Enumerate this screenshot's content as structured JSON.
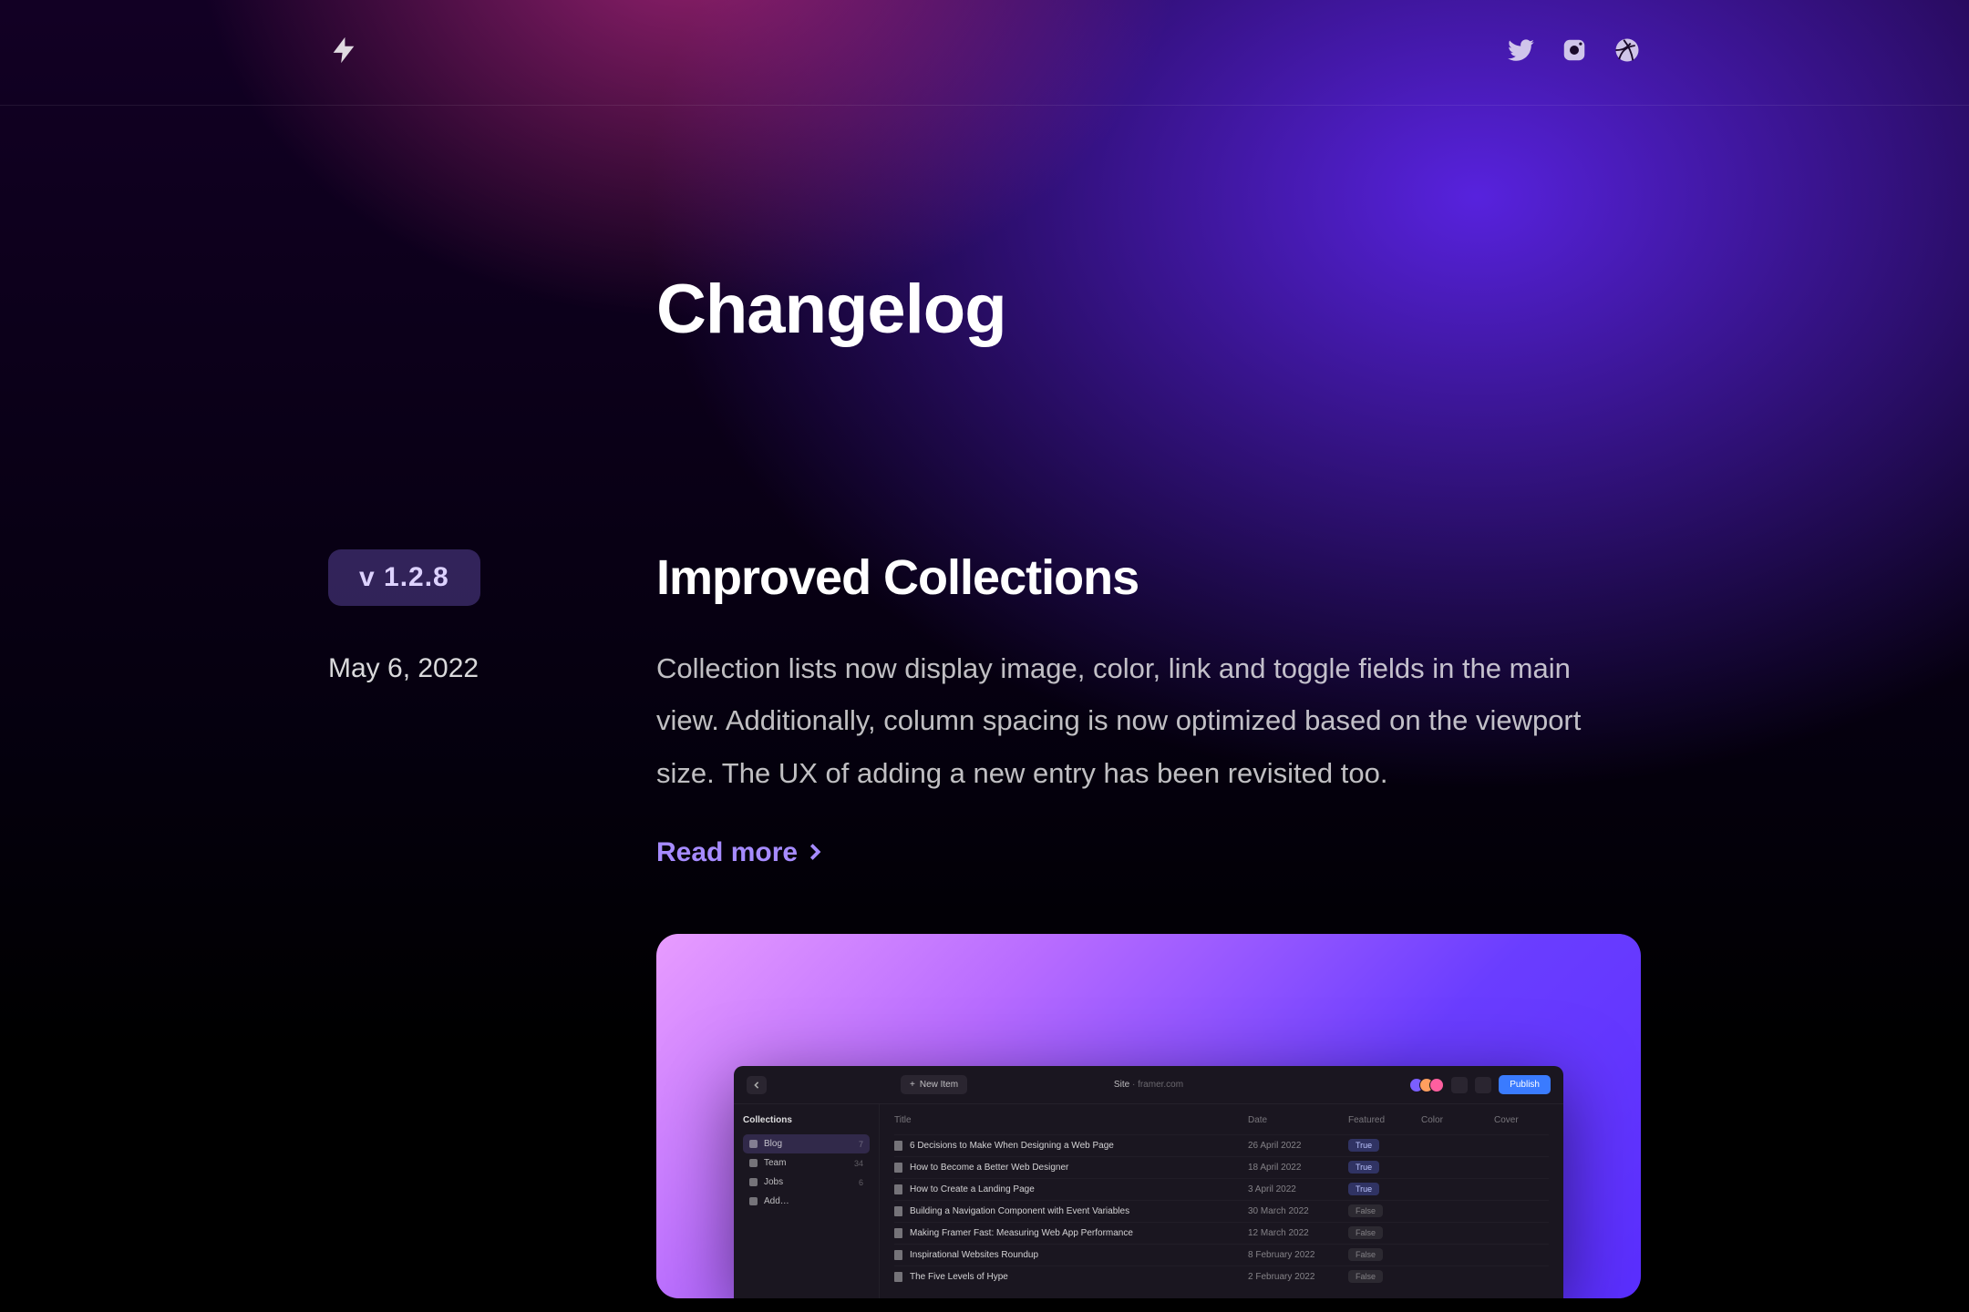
{
  "header": {
    "social": [
      "twitter",
      "instagram",
      "dribbble"
    ]
  },
  "page": {
    "title": "Changelog"
  },
  "entry": {
    "version": "v 1.2.8",
    "date": "May 6, 2022",
    "title": "Improved Collections",
    "description": "Collection lists now display image, color, link and toggle fields in the main view. Additionally, column spacing is now optimized based on the viewport size. The UX of adding a new entry has been revisited too.",
    "read_more": "Read more"
  },
  "screenshot": {
    "new_item": "New Item",
    "site_label": "Site",
    "site_value": "framer.com",
    "publish": "Publish",
    "sidebar_heading": "Collections",
    "sidebar": [
      {
        "label": "Blog",
        "count": "7",
        "active": true
      },
      {
        "label": "Team",
        "count": "34",
        "active": false
      },
      {
        "label": "Jobs",
        "count": "6",
        "active": false
      },
      {
        "label": "Add…",
        "count": "",
        "active": false
      }
    ],
    "columns": [
      "Title",
      "Date",
      "Featured",
      "Color",
      "Cover"
    ],
    "rows": [
      {
        "title": "6 Decisions to Make When Designing a Web Page",
        "date": "26 April 2022",
        "featured": "True",
        "color": "#7aa8ff"
      },
      {
        "title": "How to Become a Better Web Designer",
        "date": "18 April 2022",
        "featured": "True",
        "color": "#a8b4ff"
      },
      {
        "title": "How to Create a Landing Page",
        "date": "3 April 2022",
        "featured": "True",
        "color": "#c8a8ff"
      },
      {
        "title": "Building a Navigation Component with Event Variables",
        "date": "30 March 2022",
        "featured": "False",
        "color": "#ff8fd0"
      },
      {
        "title": "Making Framer Fast: Measuring Web App Performance",
        "date": "12 March 2022",
        "featured": "False",
        "color": "#ff6f8f"
      },
      {
        "title": "Inspirational Websites Roundup",
        "date": "8 February 2022",
        "featured": "False",
        "color": "#ffb86f"
      },
      {
        "title": "The Five Levels of Hype",
        "date": "2 February 2022",
        "featured": "False",
        "color": "#ffd86f"
      }
    ]
  }
}
